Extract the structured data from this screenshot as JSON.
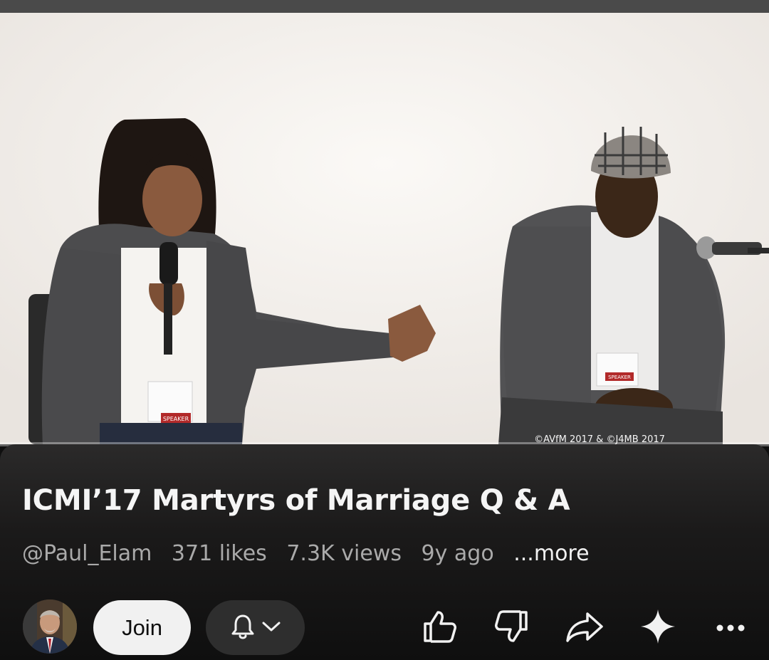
{
  "video": {
    "watermark": "©AVfM 2017 & ©J4MB 2017",
    "badge_left": "SPEAKER",
    "badge_right": "SPEAKER",
    "progress_fraction": 0.0
  },
  "title": "ICMI’17 Martyrs of Marriage Q & A",
  "meta": {
    "channel": "@Paul_Elam",
    "likes": "371 likes",
    "views": "7.3K views",
    "age": "9y ago",
    "more": "...more"
  },
  "actions": {
    "join_label": "Join",
    "icons": [
      "bell-icon",
      "chevron-down-icon",
      "thumbs-up-icon",
      "thumbs-down-icon",
      "share-icon",
      "sparkle-icon",
      "more-icon"
    ]
  },
  "colors": {
    "background": "#0f0f0f",
    "join_bg": "#f1f1f1",
    "pill_bg": "#2e2e2e",
    "progress": "#ff0033"
  }
}
